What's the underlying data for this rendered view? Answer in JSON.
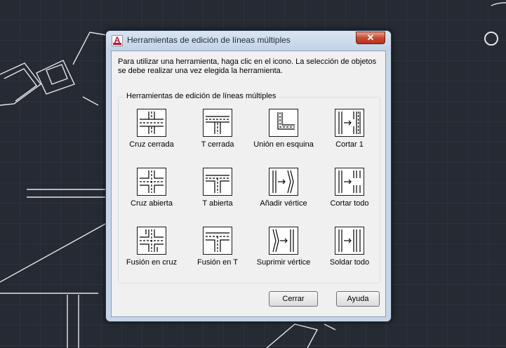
{
  "dialog": {
    "title": "Herramientas de edición de líneas múltiples",
    "app_icon_letter": "A",
    "close_glyph": "✕",
    "instructions": "Para utilizar una herramienta, haga clic en el icono. La selección de objetos se debe realizar una vez elegida la herramienta.",
    "group_label": "Herramientas de edición de líneas múltiples",
    "tools": [
      {
        "label": "Cruz cerrada",
        "icon": "closed-cross-icon"
      },
      {
        "label": "T cerrada",
        "icon": "closed-tee-icon"
      },
      {
        "label": "Unión en esquina",
        "icon": "corner-joint-icon"
      },
      {
        "label": "Cortar 1",
        "icon": "cut-single-icon"
      },
      {
        "label": "Cruz abierta",
        "icon": "open-cross-icon"
      },
      {
        "label": "T abierta",
        "icon": "open-tee-icon"
      },
      {
        "label": "Añadir vértice",
        "icon": "add-vertex-icon"
      },
      {
        "label": "Cortar todo",
        "icon": "cut-all-icon"
      },
      {
        "label": "Fusión en cruz",
        "icon": "merged-cross-icon"
      },
      {
        "label": "Fusión en T",
        "icon": "merged-tee-icon"
      },
      {
        "label": "Suprimir vértice",
        "icon": "delete-vertex-icon"
      },
      {
        "label": "Soldar todo",
        "icon": "weld-all-icon"
      }
    ],
    "buttons": {
      "close": "Cerrar",
      "help": "Ayuda"
    }
  },
  "colors": {
    "canvas_bg": "#252a33",
    "dialog_frame": "#c6d6e8",
    "close_red": "#c74a33"
  }
}
